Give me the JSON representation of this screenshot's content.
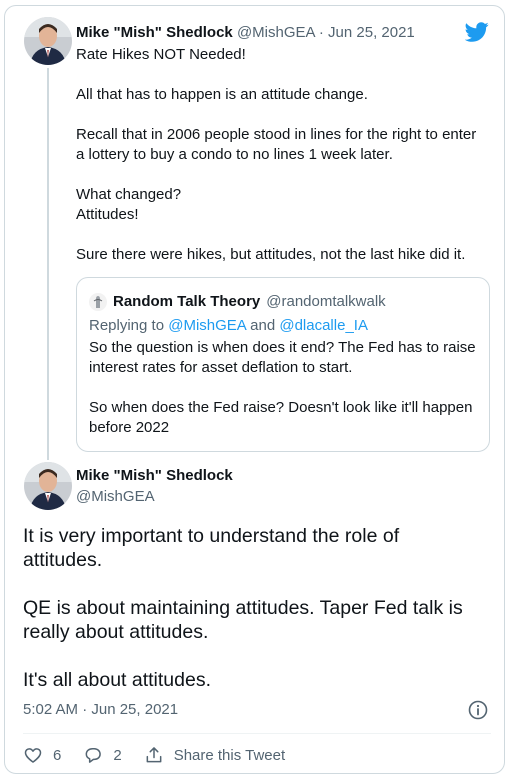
{
  "parent_tweet": {
    "display_name": "Mike \"Mish\" Shedlock",
    "handle": "@MishGEA",
    "separator": "·",
    "date": "Jun 25, 2021",
    "lines": [
      "Rate Hikes NOT Needed!",
      "",
      "All that has to happen is an attitude change.",
      "",
      "Recall that in 2006 people stood in lines for the right to enter",
      "a lottery to buy a condo to no lines 1 week later.",
      "",
      "What changed?",
      "Attitudes!",
      "",
      "Sure there were hikes, but attitudes, not the last hike did it."
    ]
  },
  "quoted_tweet": {
    "display_name": "Random Talk Theory",
    "handle": "@randomtalkwalk",
    "replying_prefix": "Replying to",
    "replying_user1": "@MishGEA",
    "replying_and": "and",
    "replying_user2": "@dlacalle_IA",
    "lines": [
      "So the question is when does it end? The Fed has to raise",
      "interest rates for asset deflation to start.",
      "",
      "So when does the Fed raise? Doesn't look like it'll happen",
      "before 2022"
    ]
  },
  "main_tweet": {
    "display_name": "Mike \"Mish\" Shedlock",
    "handle": "@MishGEA",
    "lines": [
      "It is very important to understand the role of",
      "attitudes.",
      "",
      "QE is about maintaining attitudes. Taper Fed talk is",
      "really about attitudes.",
      "",
      "It's all about attitudes."
    ],
    "timestamp": "5:02 AM · Jun 25, 2021"
  },
  "actions": {
    "like_count": "6",
    "reply_count": "2",
    "share_label": "Share this Tweet"
  },
  "colors": {
    "brand_blue": "#1d9bf0",
    "muted_text": "#536471",
    "border": "#cfd9de"
  },
  "icons": [
    "twitter-logo-icon",
    "info-icon",
    "heart-icon",
    "reply-icon",
    "share-icon"
  ]
}
